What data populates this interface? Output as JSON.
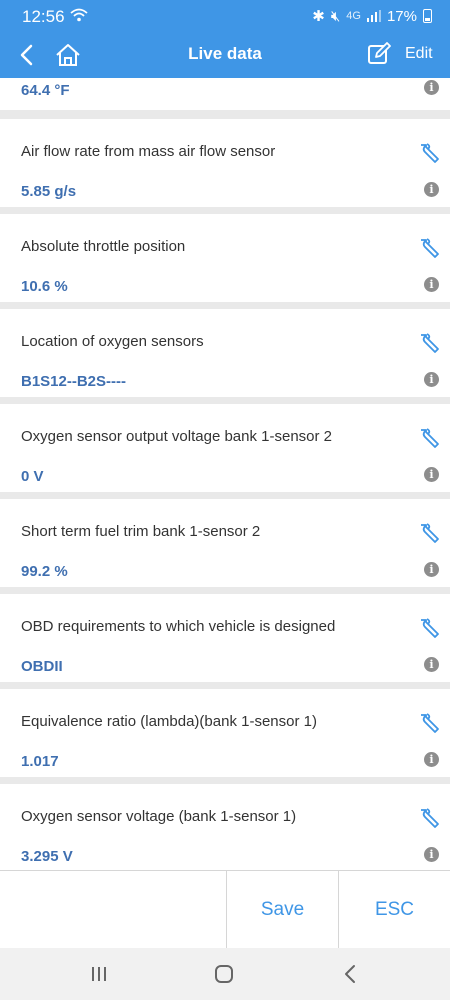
{
  "status_bar": {
    "time": "12:56",
    "network": "4G",
    "battery": "17%"
  },
  "app_bar": {
    "title": "Live data",
    "edit_label": "Edit"
  },
  "partial_item": {
    "value": "64.4 °F"
  },
  "items": [
    {
      "name": "Air flow rate from mass air flow sensor",
      "value": "5.85 g/s"
    },
    {
      "name": "Absolute throttle position",
      "value": "10.6 %"
    },
    {
      "name": "Location of oxygen sensors",
      "value": "B1S12--B2S----"
    },
    {
      "name": "Oxygen sensor output voltage bank 1-sensor 2",
      "value": "0 V"
    },
    {
      "name": "Short term fuel trim bank 1-sensor 2",
      "value": "99.2 %"
    },
    {
      "name": "OBD requirements to which vehicle is designed",
      "value": "OBDII"
    },
    {
      "name": "Equivalence ratio (lambda)(bank 1-sensor 1)",
      "value": "1.017"
    },
    {
      "name": "Oxygen sensor voltage (bank 1-sensor 1)",
      "value": "3.295 V"
    }
  ],
  "icons": {
    "info_glyph": "i"
  },
  "bottom_bar": {
    "save_label": "Save",
    "esc_label": "ESC"
  },
  "colors": {
    "accent": "#3f96e6",
    "value_text": "#3f6fb0"
  }
}
